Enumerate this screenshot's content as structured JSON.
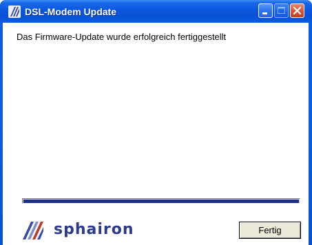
{
  "window": {
    "title": "DSL-Modem Update",
    "controls": {
      "minimize": "minimize",
      "maximize": "maximize",
      "close": "close"
    }
  },
  "main": {
    "message": "Das Firmware-Update wurde erfolgreich fertiggestellt",
    "progress_percent": 100
  },
  "footer": {
    "brand": "sphairon",
    "finish_label": "Fertig"
  },
  "colors": {
    "titlebar": "#0a56e0",
    "progress_fill": "#1c2f8f",
    "brand": "#2b3a8f",
    "close_button": "#d9563a"
  },
  "icons": [
    "app-stripes-icon",
    "minimize-icon",
    "maximize-icon",
    "close-icon",
    "sphairon-logo-icon"
  ]
}
